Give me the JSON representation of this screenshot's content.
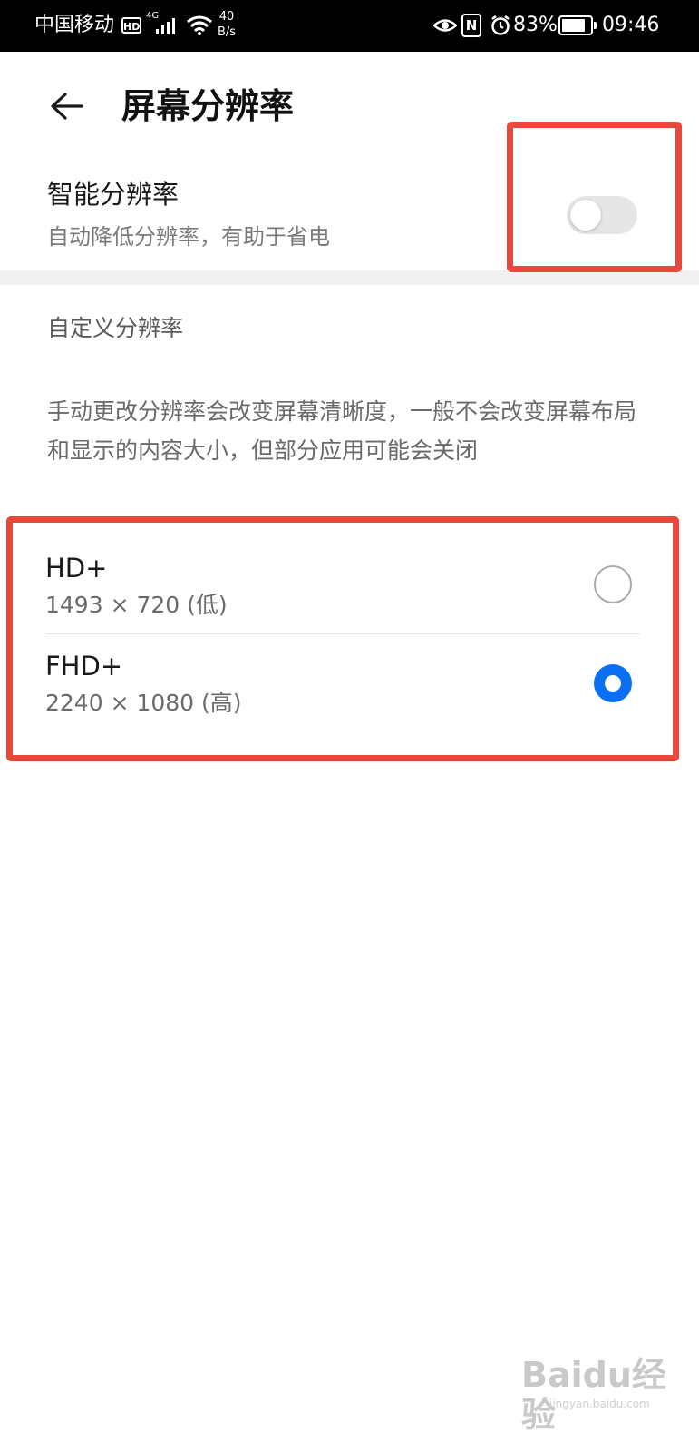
{
  "status_bar": {
    "carrier": "中国移动",
    "hd_badge": "HD",
    "network_type": "4G",
    "speed_value": "40",
    "speed_unit": "B/s",
    "battery_percent": "83%",
    "battery_level": 0.83,
    "time": "09:46"
  },
  "header": {
    "title": "屏幕分辨率"
  },
  "smart_resolution": {
    "title": "智能分辨率",
    "subtitle": "自动降低分辨率，有助于省电",
    "enabled": false
  },
  "custom_resolution": {
    "section_title": "自定义分辨率",
    "description": "手动更改分辨率会改变屏幕清晰度，一般不会改变屏幕布局和显示的内容大小，但部分应用可能会关闭",
    "options": [
      {
        "name": "HD+",
        "detail": "1493 × 720 (低)",
        "selected": false
      },
      {
        "name": "FHD+",
        "detail": "2240 × 1080 (高)",
        "selected": true
      }
    ]
  },
  "colors": {
    "accent": "#0a6ff2",
    "annotation": "#e8493a"
  },
  "watermark": {
    "logo": "Baidu经验",
    "url": "jingyan.baidu.com"
  }
}
